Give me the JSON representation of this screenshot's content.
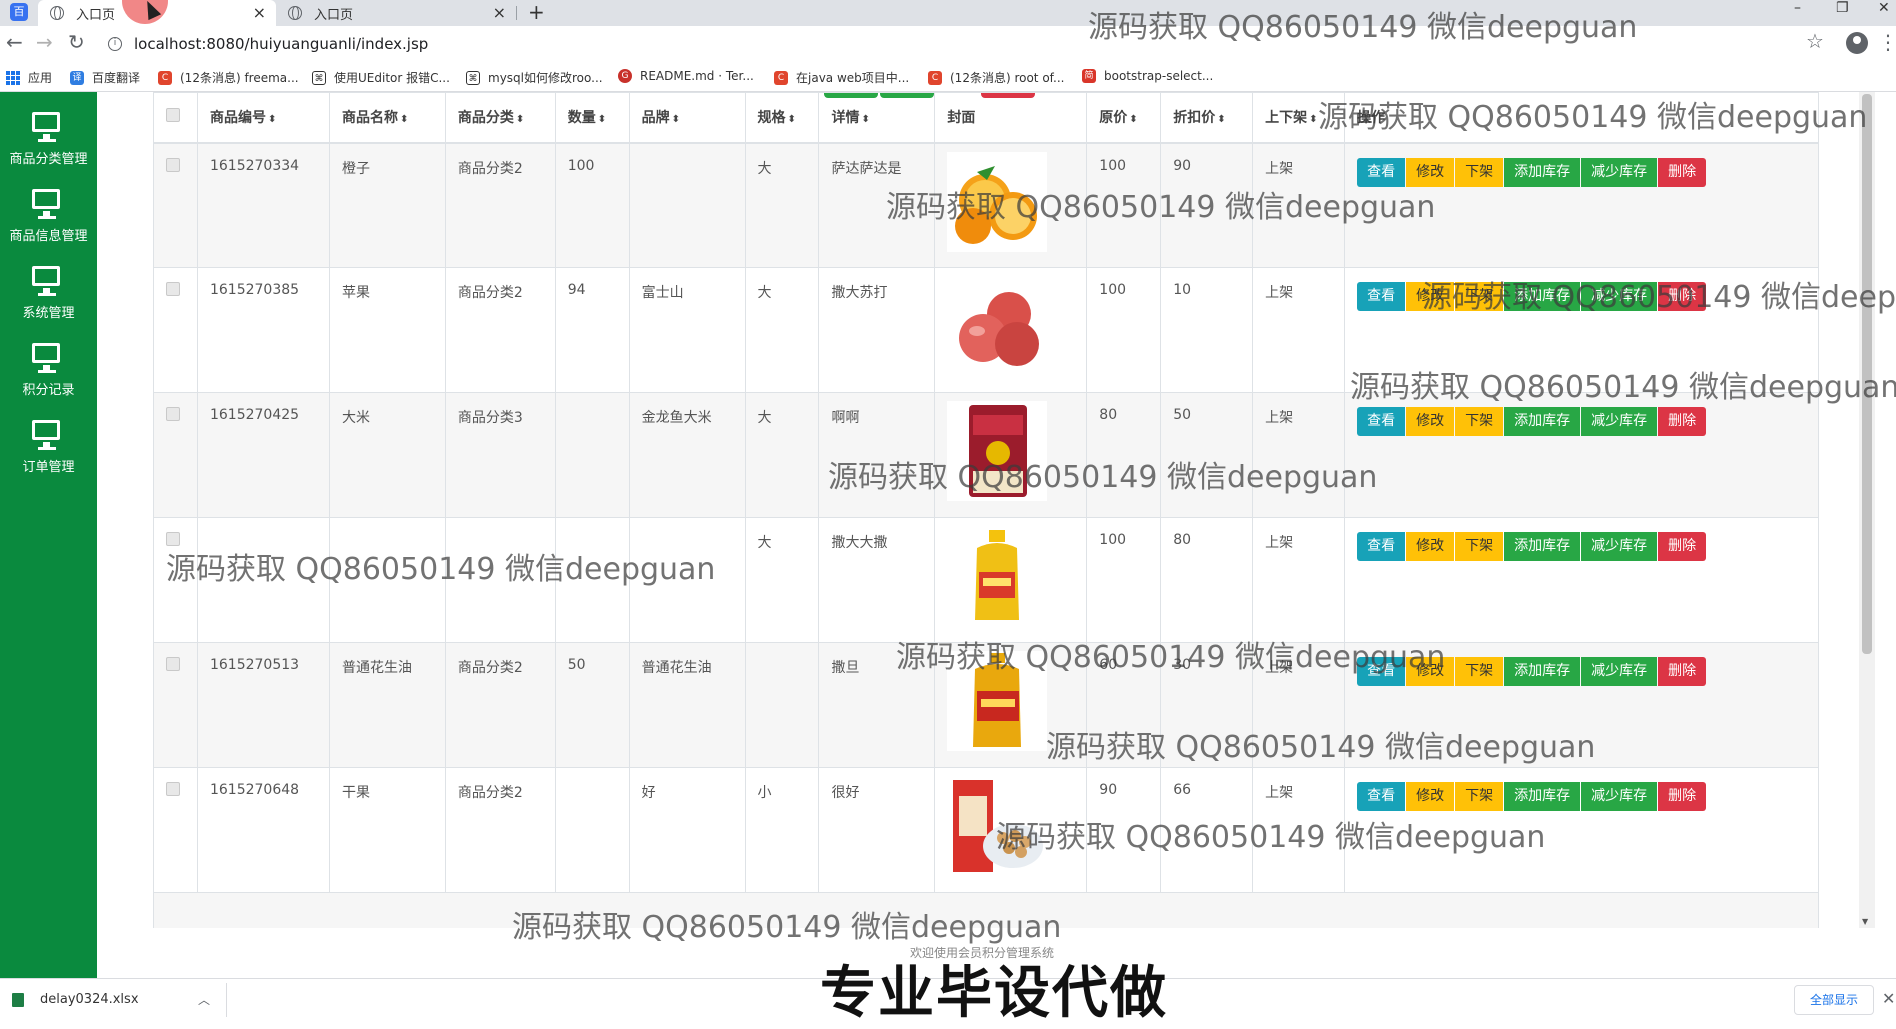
{
  "browser": {
    "tabs": [
      {
        "title": "入口页"
      },
      {
        "title": "入口页"
      }
    ],
    "url": "localhost:8080/huiyuanguanli/index.jsp",
    "bookmarks": [
      {
        "label": "应用"
      },
      {
        "label": "百度翻译"
      },
      {
        "label": "(12条消息) freema..."
      },
      {
        "label": "使用UEditor 报错C..."
      },
      {
        "label": "mysql如何修改roo..."
      },
      {
        "label": "README.md · Ter..."
      },
      {
        "label": "在java web项目中..."
      },
      {
        "label": "(12条消息) root of..."
      },
      {
        "label": "bootstrap-select..."
      }
    ]
  },
  "sidebar": {
    "items": [
      {
        "label": "商品分类管理"
      },
      {
        "label": "商品信息管理"
      },
      {
        "label": "系统管理"
      },
      {
        "label": "积分记录"
      },
      {
        "label": "订单管理"
      }
    ]
  },
  "table": {
    "headers": [
      "商品编号",
      "商品名称",
      "商品分类",
      "数量",
      "品牌",
      "规格",
      "详情",
      "封面",
      "原价",
      "折扣价",
      "上下架",
      "操作"
    ],
    "actions": {
      "view": "查看",
      "edit": "修改",
      "off": "下架",
      "add_stock": "添加库存",
      "reduce_stock": "减少库存",
      "delete": "删除"
    },
    "rows": [
      {
        "id": "1615270334",
        "name": "橙子",
        "category": "商品分类2",
        "qty": "100",
        "brand": "",
        "spec": "大",
        "detail": "萨达萨达是",
        "cover": "orange-image",
        "price": "100",
        "discount": "90",
        "status": "上架"
      },
      {
        "id": "1615270385",
        "name": "苹果",
        "category": "商品分类2",
        "qty": "94",
        "brand": "富士山",
        "spec": "大",
        "detail": "撒大苏打",
        "cover": "apple-image",
        "price": "100",
        "discount": "10",
        "status": "上架"
      },
      {
        "id": "1615270425",
        "name": "大米",
        "category": "商品分类3",
        "qty": "",
        "brand": "金龙鱼大米",
        "spec": "大",
        "detail": "啊啊",
        "cover": "rice-bag-image",
        "price": "80",
        "discount": "50",
        "status": "上架"
      },
      {
        "id": "",
        "name": "",
        "category": "",
        "qty": "",
        "brand": "",
        "spec": "大",
        "detail": "撒大大撒",
        "cover": "oil-bottle-image",
        "price": "100",
        "discount": "80",
        "status": "上架"
      },
      {
        "id": "1615270513",
        "name": "普通花生油",
        "category": "商品分类2",
        "qty": "50",
        "brand": "普通花生油",
        "spec": "",
        "detail": "撒旦",
        "cover": "peanut-oil-image",
        "price": "60",
        "discount": "30",
        "status": "上架"
      },
      {
        "id": "1615270648",
        "name": "干果",
        "category": "商品分类2",
        "qty": "",
        "brand": "好",
        "spec": "小",
        "detail": "很好",
        "cover": "dried-fruit-image",
        "price": "90",
        "discount": "66",
        "status": "上架"
      }
    ]
  },
  "footer": {
    "text": "欢迎使用会员积分管理系统"
  },
  "watermark": "源码获取 QQ86050149 微信deepguan",
  "caption": "专业毕设代做",
  "download": {
    "file": "delay0324.xlsx",
    "show_all": "全部显示"
  },
  "colors": {
    "sidebar": "#0a8a3e",
    "view": "#17a2b8",
    "warn": "#ffc107",
    "success": "#28a745",
    "danger": "#dc3545"
  }
}
